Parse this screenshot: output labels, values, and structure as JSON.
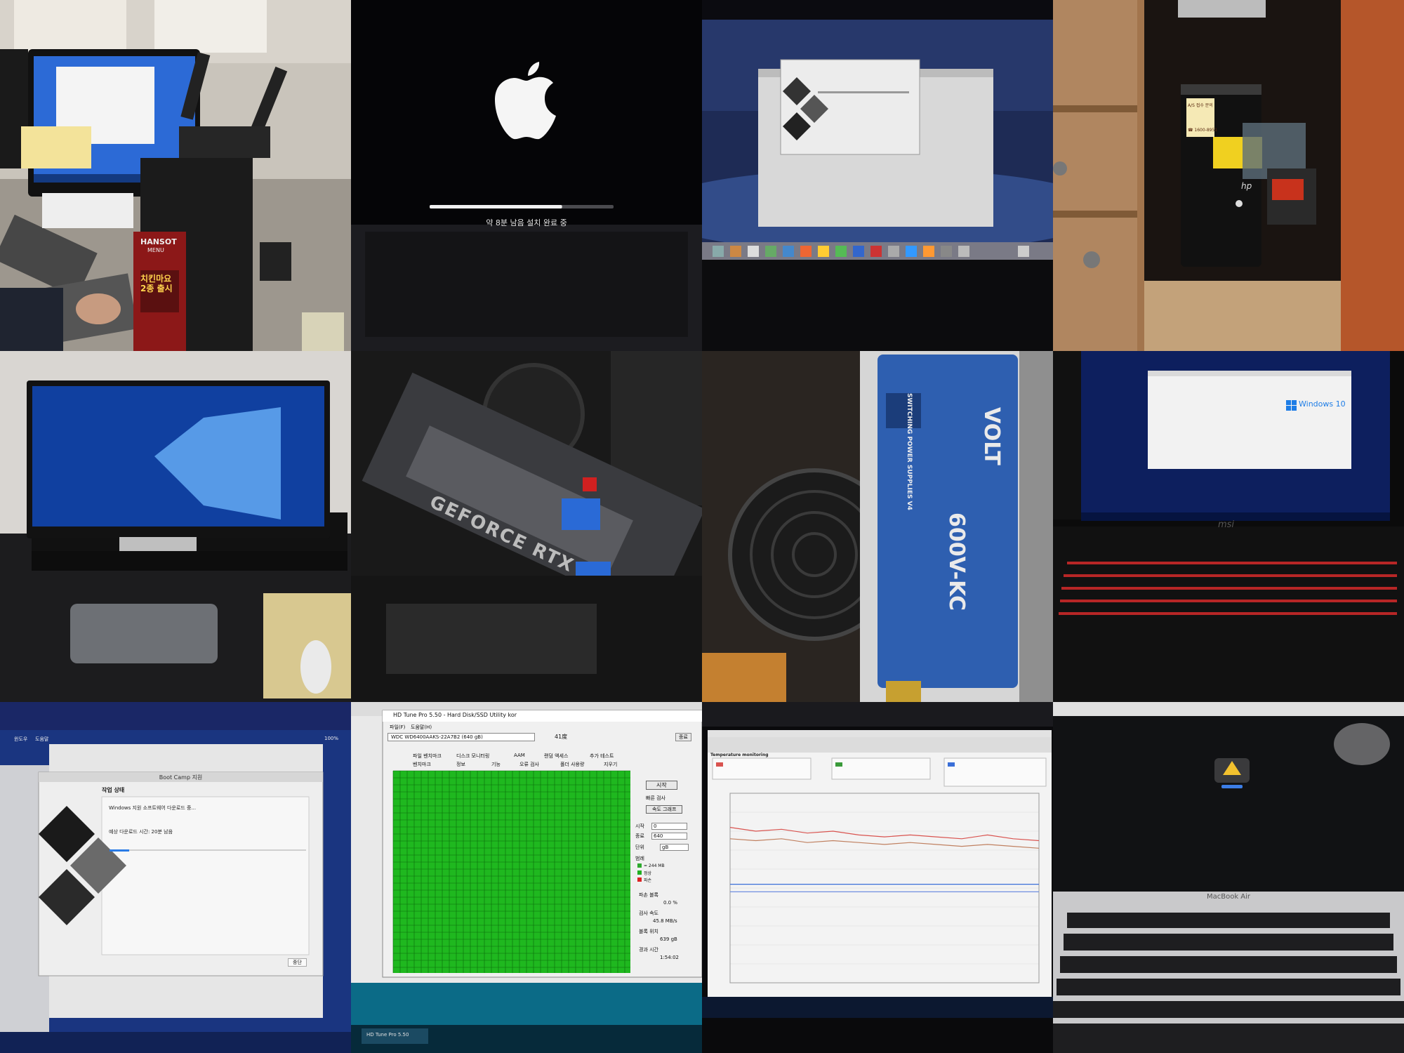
{
  "tiles": {
    "office_pc": {
      "sticker_brand": "HANSOT",
      "sticker_menu": "MENU",
      "sticker_promo": "치킨마요\n2종 출시"
    },
    "mac_boot": {
      "status_text": "약 8분 남음 설치 완료 중",
      "progress": 0.72
    },
    "hp_tower": {
      "sticker_line1": "A/S 접수 문의",
      "sticker_phone": "☎ 1600-8951",
      "brand": "hp"
    },
    "psu": {
      "brand": "VOLT",
      "model": "600V-KC",
      "label_side": "SWITCHING POWER SUPPLIES V4"
    },
    "msi_laptop": {
      "os_label": "Windows 10",
      "brand": "msi"
    },
    "gpu": {
      "label": "GEFORCE RTX"
    },
    "bootcamp": {
      "window_title": "Boot Camp 지원",
      "heading": "작업 상태",
      "line1": "Windows 지원 소프트웨어 다운로드 중...",
      "line2": "예상 다운로드 시간: 20분 남음",
      "stop_button": "중단",
      "progress": 0.1,
      "menu_items": [
        "윈도우",
        "도움말"
      ],
      "battery": "100%"
    },
    "hdtune": {
      "window_title": "HD Tune Pro 5.50 - Hard Disk/SSD Utility kor",
      "menu_items": [
        "파일(F)",
        "도움말(H)"
      ],
      "drive": "WDC WD6400AAKS-22A7B2 (640 gB)",
      "temperature": "41度",
      "exit_button": "종료",
      "tabs_row1": [
        "파일 벤치마크",
        "디스크 모니터링",
        "AAM",
        "랜덤 액세스",
        "추가 테스트"
      ],
      "tabs_row2": [
        "벤치마크",
        "정보",
        "기능",
        "오류 검사",
        "폴더 사용량",
        "지우기"
      ],
      "start_button": "시작",
      "quick_scan": "빠른 검사",
      "speed_graph": "속도 그래프",
      "start_label": "시작",
      "start_value": "0",
      "end_label": "종료",
      "end_value": "640",
      "unit_label": "단위",
      "unit_value": "gB",
      "legend_title": "범례",
      "legend": [
        {
          "label": "= 244 MB",
          "color": "#2eaa2e"
        },
        {
          "label": "정상",
          "color": "#22b022"
        },
        {
          "label": "파손",
          "color": "#dd2222"
        }
      ],
      "damaged_label": "파손 블록",
      "damaged_value": "0.0 %",
      "scan_speed_label": "검사 속도",
      "scan_speed_value": "45.8 MB/s",
      "position_label": "블록 위치",
      "position_value": "639 gB",
      "elapsed_label": "경과 시간",
      "elapsed_value": "1:54:02",
      "taskbar_item": "HD Tune Pro 5.50"
    },
    "temp_monitor": {
      "title": "Temperature monitoring",
      "chart_data": {
        "type": "line",
        "title": "",
        "xlabel": "",
        "ylabel": "",
        "ylim": [
          0,
          100
        ],
        "x": [
          0,
          1,
          2,
          3,
          4,
          5,
          6,
          7,
          8,
          9,
          10,
          11,
          12
        ],
        "series": [
          {
            "values": [
              82,
              80,
              81,
              79,
              80,
              78,
              77,
              78,
              77,
              76,
              78,
              76,
              75
            ]
          },
          {
            "values": [
              76,
              75,
              76,
              74,
              75,
              74,
              73,
              74,
              73,
              72,
              73,
              72,
              71
            ]
          },
          {
            "values": [
              52,
              52,
              52,
              52,
              52,
              52,
              52,
              52,
              52,
              52,
              52,
              52,
              52
            ]
          },
          {
            "values": [
              48,
              48,
              48,
              48,
              48,
              48,
              48,
              48,
              48,
              48,
              48,
              48,
              48
            ]
          }
        ],
        "colors": [
          "#d9534f",
          "#c08060",
          "#3a6fd8",
          "#6f8fe0"
        ],
        "grid": true
      }
    },
    "macbook_air": {
      "brand": "MacBook Air"
    }
  }
}
